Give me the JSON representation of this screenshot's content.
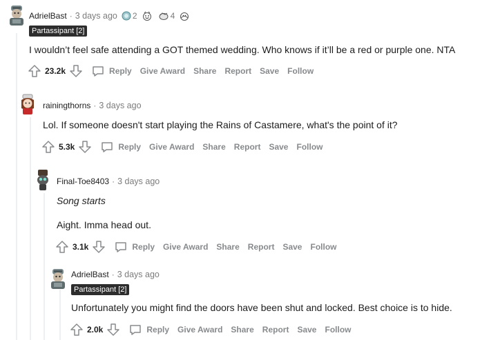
{
  "comments": [
    {
      "author": "AdrielBast",
      "time": "3 days ago",
      "awards": [
        {
          "icon": "silver-coin-award-icon",
          "count": "2"
        },
        {
          "icon": "wholesome-award-icon",
          "count": ""
        },
        {
          "icon": "helpful-award-icon",
          "count": "4"
        },
        {
          "icon": "hug-award-icon",
          "count": ""
        }
      ],
      "flair": "Partassipant [2]",
      "lines": [
        "I wouldn’t feel safe attending a GOT themed wedding. Who knows if it’ll be a red or purple one. NTA"
      ],
      "votes": "23.2k"
    },
    {
      "author": "rainingthorns",
      "time": "3 days ago",
      "lines": [
        "Lol. If someone doesn't start playing the Rains of Castamere, what's the point of it?"
      ],
      "votes": "5.3k"
    },
    {
      "author": "Final-Toe8403",
      "time": "3 days ago",
      "lines": [
        "Song starts",
        "Aight. Imma head out."
      ],
      "votes": "3.1k"
    },
    {
      "author": "AdrielBast",
      "time": "3 days ago",
      "flair": "Partassipant [2]",
      "lines": [
        "Unfortunately you might find the doors have been shut and locked. Best choice is to hide."
      ],
      "votes": "2.0k"
    }
  ],
  "actions": {
    "reply": "Reply",
    "give_award": "Give Award",
    "share": "Share",
    "report": "Report",
    "save": "Save",
    "follow": "Follow"
  },
  "separator": "·"
}
